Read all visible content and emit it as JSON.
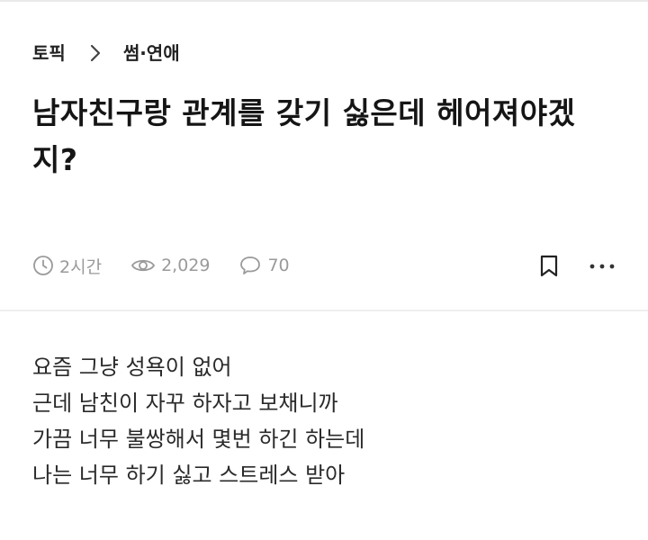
{
  "breadcrumb": {
    "topic": "토픽",
    "category": "썸·연애"
  },
  "post": {
    "title": "남자친구랑 관계를 갖기 싫은데 헤어져야겠지?",
    "meta": {
      "time": "2시간",
      "views": "2,029",
      "comments": "70"
    },
    "body_lines": [
      "요즘 그냥 성욕이 없어",
      "근데 남친이 자꾸 하자고 보채니까",
      "가끔 너무 불쌍해서 몇번 하긴 하는데",
      "나는 너무 하기 싫고 스트레스 받아"
    ]
  },
  "icons": {
    "breadcrumb_separator": "chevron-right-icon",
    "time": "clock-icon",
    "views": "eye-icon",
    "comments": "comment-bubble-icon",
    "bookmark": "bookmark-icon",
    "more": "more-dots-icon"
  },
  "colors": {
    "title": "#151515",
    "meta": "#9a9a9a",
    "divider": "#eeeeee"
  }
}
